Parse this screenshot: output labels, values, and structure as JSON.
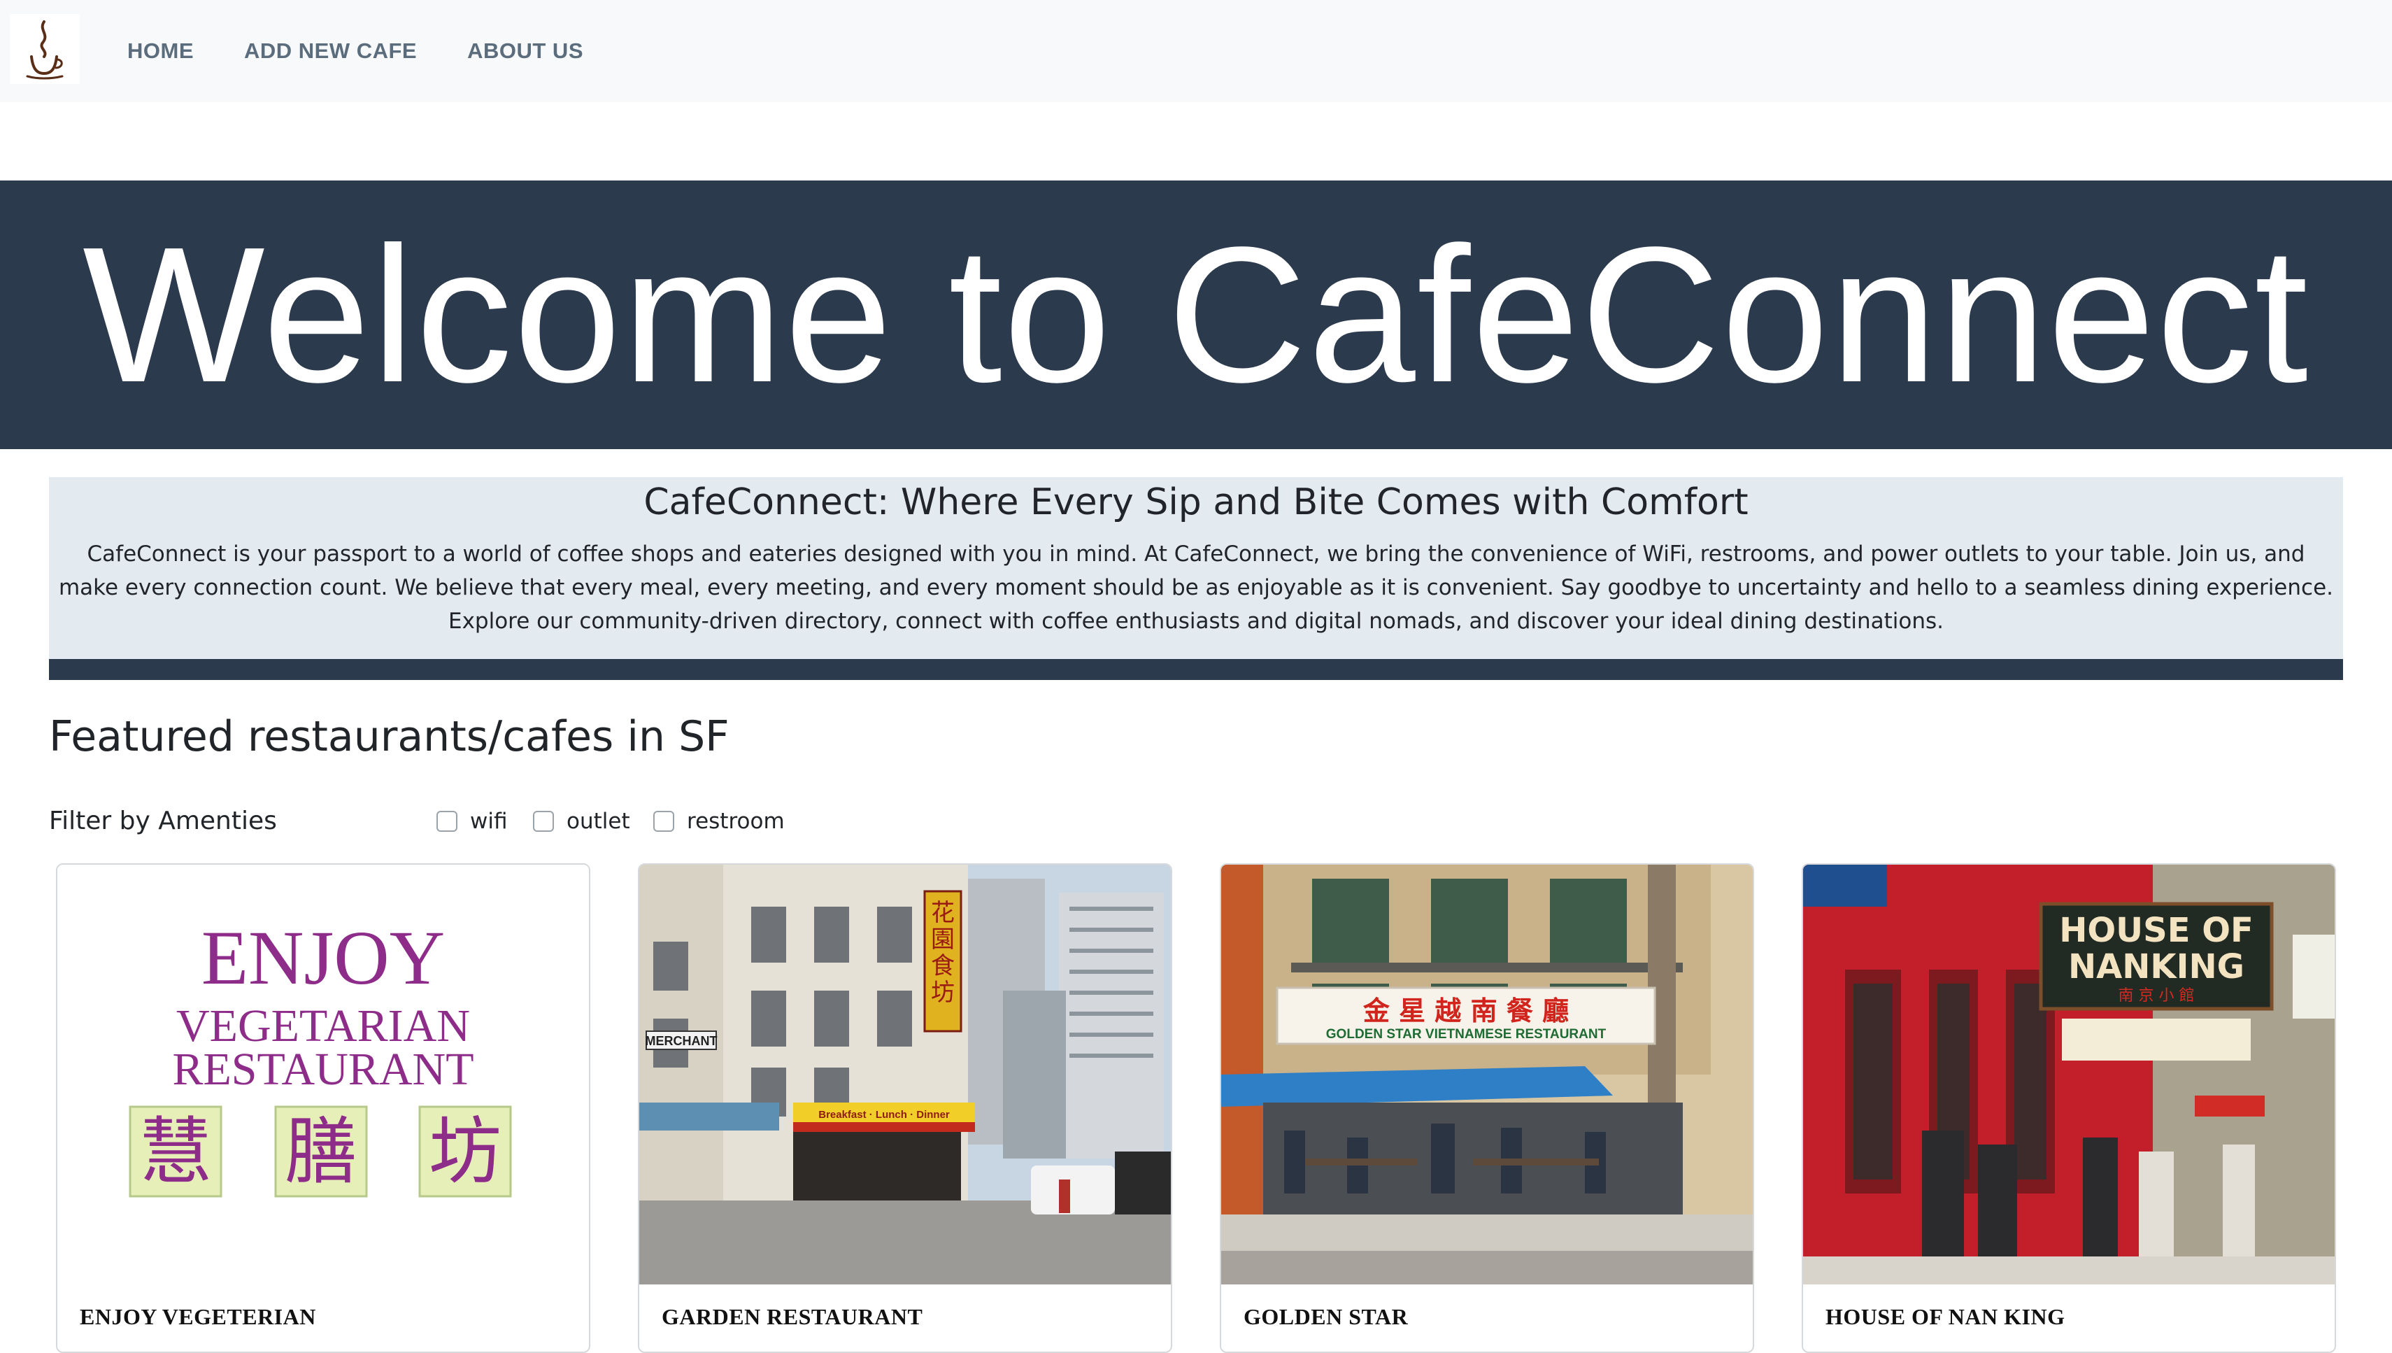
{
  "nav": {
    "logo": "coffee-cup-icon",
    "links": [
      "HOME",
      "ADD NEW CAFE",
      "ABOUT US"
    ]
  },
  "hero": {
    "title": "Welcome to CafeConnect"
  },
  "intro": {
    "heading": "CafeConnect: Where Every Sip and Bite Comes with Comfort",
    "text": "CafeConnect is your passport to a world of coffee shops and eateries designed with you in mind. At CafeConnect, we bring the convenience of WiFi, restrooms, and power outlets to your table. Join us, and make every connection count. We believe that every meal, every meeting, and every moment should be as enjoyable as it is convenient. Say goodbye to uncertainty and hello to a seamless dining experience. Explore our community-driven directory, connect with coffee enthusiasts and digital nomads, and discover your ideal dining destinations."
  },
  "featured": {
    "heading": "Featured restaurants/cafes in SF",
    "filter_label": "Filter by Amenties",
    "filters": [
      {
        "label": "wifi",
        "checked": false
      },
      {
        "label": "outlet",
        "checked": false
      },
      {
        "label": "restroom",
        "checked": false
      }
    ]
  },
  "cards": [
    {
      "title": "ENJOY VEGETERIAN",
      "logo_lines": [
        "ENJOY",
        "VEGETARIAN",
        "RESTAURANT"
      ],
      "logo_chars": [
        "慧",
        "膳",
        "坊"
      ]
    },
    {
      "title": "GARDEN RESTAURANT",
      "street_sign": "MERCHANT",
      "vertical_sign": "花園食坊",
      "awning": "Breakfast · Lunch · Dinner"
    },
    {
      "title": "GOLDEN STAR",
      "sign_chinese": "金 星 越 南 餐 廳",
      "sign_english": "GOLDEN STAR VIETNAMESE RESTAURANT"
    },
    {
      "title": "HOUSE OF NAN KING",
      "sign_lines": [
        "HOUSE OF",
        "NANKING"
      ],
      "sign_sub": "南 京 小 館"
    }
  ],
  "colors": {
    "navbar_bg": "#f8f9fa",
    "nav_link": "#5b6d7c",
    "hero_bg": "#2c3a4d",
    "intro_bg": "#e3ebf1"
  }
}
